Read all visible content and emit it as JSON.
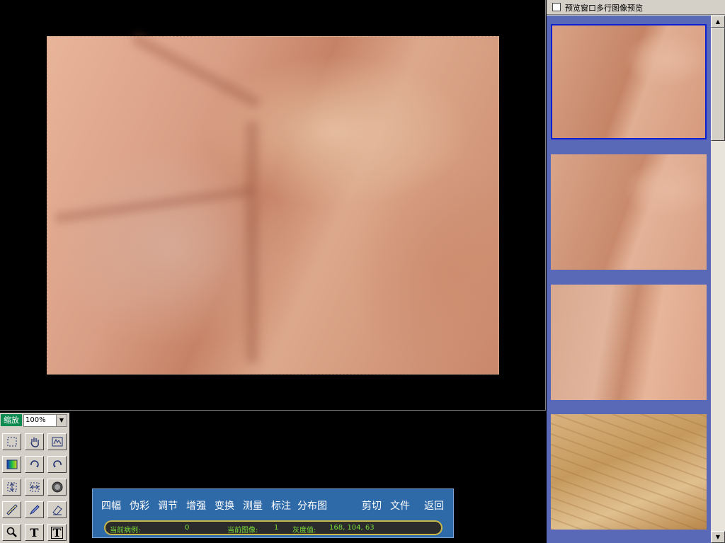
{
  "preview_panel": {
    "checkbox_label": "预览窗口多行图像预览",
    "thumbnails": [
      "thumb-1",
      "thumb-2",
      "thumb-3",
      "thumb-4"
    ],
    "selected_index": 0
  },
  "tools": {
    "zoom_label": "缩放",
    "zoom_value": "100%",
    "buttons": [
      {
        "name": "select-rect-icon"
      },
      {
        "name": "pan-hand-icon"
      },
      {
        "name": "fit-window-icon"
      },
      {
        "name": "pseudo-color-icon"
      },
      {
        "name": "rotate-right-icon"
      },
      {
        "name": "rotate-left-icon"
      },
      {
        "name": "fit-height-icon"
      },
      {
        "name": "fit-width-icon"
      },
      {
        "name": "lens-icon"
      },
      {
        "name": "ruler-icon"
      },
      {
        "name": "pen-icon"
      },
      {
        "name": "eraser-icon"
      },
      {
        "name": "zoom-icon"
      },
      {
        "name": "text-icon",
        "glyph": "T"
      },
      {
        "name": "text-box-icon",
        "glyph": "T"
      }
    ]
  },
  "menu": {
    "items": [
      "四幅",
      "伪彩",
      "调节",
      "增强",
      "变换",
      "测量",
      "标注",
      "分布图",
      "剪切",
      "文件",
      "返回"
    ]
  },
  "status": {
    "case_label": "当前病例:",
    "case_value": "0",
    "image_label": "当前图像:",
    "image_value": "1",
    "gray_label": "灰度值:",
    "gray_value": "168, 104, 63"
  }
}
